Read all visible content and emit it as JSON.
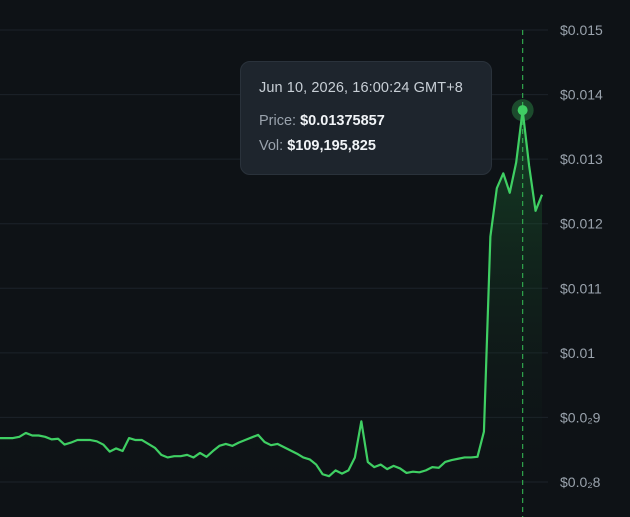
{
  "colors": {
    "background": "#0e1216",
    "grid": "#1c232a",
    "line": "#3fcf63",
    "tick_text": "#9aa3ad",
    "crosshair": "#2fa64d"
  },
  "tooltip": {
    "date": "Jun 10, 2026, 16:00:24 GMT+8",
    "price_label": "Price:",
    "price_value": "$0.01375857",
    "vol_label": "Vol:",
    "vol_value": "$109,195,825"
  },
  "chart_data": {
    "type": "area",
    "series": [
      {
        "values": [
          0.00868,
          0.00868,
          0.00868,
          0.0087,
          0.00876,
          0.00872,
          0.00872,
          0.0087,
          0.00866,
          0.00867,
          0.00858,
          0.00861,
          0.00865,
          0.00865,
          0.00865,
          0.00863,
          0.00858,
          0.00847,
          0.00852,
          0.00848,
          0.00868,
          0.00865,
          0.00865,
          0.00859,
          0.00853,
          0.00842,
          0.00838,
          0.0084,
          0.0084,
          0.00842,
          0.00838,
          0.00845,
          0.00839,
          0.00848,
          0.00856,
          0.00859,
          0.00856,
          0.00861,
          0.00865,
          0.00869,
          0.00873,
          0.00862,
          0.00857,
          0.00859,
          0.00854,
          0.00849,
          0.00844,
          0.00838,
          0.00835,
          0.00827,
          0.00812,
          0.00809,
          0.00818,
          0.00813,
          0.00818,
          0.00838,
          0.00894,
          0.00831,
          0.00823,
          0.00827,
          0.0082,
          0.00825,
          0.00821,
          0.00814,
          0.00816,
          0.00815,
          0.00818,
          0.00823,
          0.00822,
          0.00831,
          0.00834,
          0.00836,
          0.00838,
          0.00838,
          0.00839,
          0.00878,
          0.0118,
          0.01255,
          0.01278,
          0.01248,
          0.01295,
          0.013758,
          0.0129,
          0.0122,
          0.01245
        ]
      }
    ],
    "y_ticks": [
      "$0.015",
      "$0.014",
      "$0.013",
      "$0.012",
      "$0.011",
      "$0.01",
      "$0.0₂9",
      "$0.0₂8"
    ],
    "y_tick_values": [
      0.015,
      0.014,
      0.013,
      0.012,
      0.011,
      0.01,
      0.009,
      0.008
    ],
    "ylim": [
      0.0078,
      0.0153
    ],
    "grid": true,
    "highlight_index": 81,
    "highlight_value": 0.01375857
  }
}
